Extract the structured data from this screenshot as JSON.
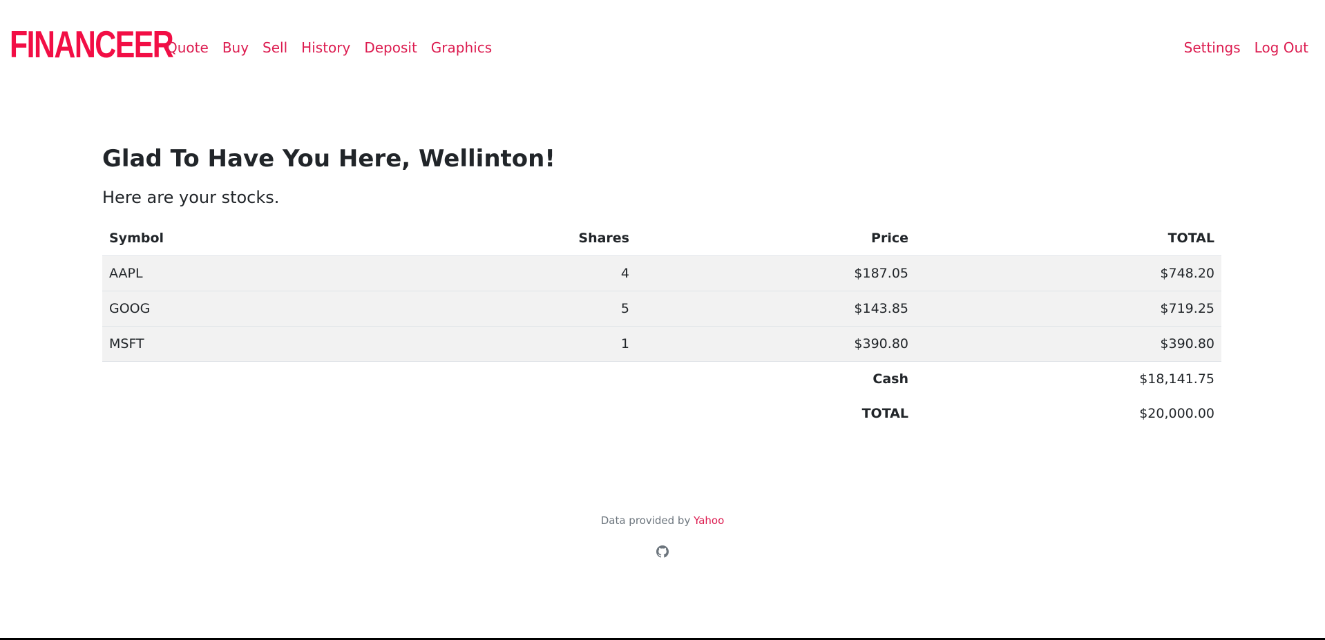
{
  "brand": {
    "name": "FINANCEER",
    "color": "#f20e45"
  },
  "nav": {
    "left": [
      {
        "label": "Quote"
      },
      {
        "label": "Buy"
      },
      {
        "label": "Sell"
      },
      {
        "label": "History"
      },
      {
        "label": "Deposit"
      },
      {
        "label": "Graphics"
      }
    ],
    "right": [
      {
        "label": "Settings"
      },
      {
        "label": "Log Out"
      }
    ],
    "link_color": "#dc1b4f"
  },
  "main": {
    "heading": "Glad To Have You Here, Wellinton!",
    "subheading": "Here are your stocks."
  },
  "table": {
    "headers": {
      "symbol": "Symbol",
      "shares": "Shares",
      "price": "Price",
      "total": "TOTAL"
    },
    "rows": [
      {
        "symbol": "AAPL",
        "shares": "4",
        "price": "$187.05",
        "total": "$748.20"
      },
      {
        "symbol": "GOOG",
        "shares": "5",
        "price": "$143.85",
        "total": "$719.25"
      },
      {
        "symbol": "MSFT",
        "shares": "1",
        "price": "$390.80",
        "total": "$390.80"
      }
    ],
    "cash": {
      "label": "Cash",
      "value": "$18,141.75"
    },
    "grand_total": {
      "label": "TOTAL",
      "value": "$20,000.00"
    }
  },
  "footer": {
    "text": "Data provided by",
    "link_label": "Yahoo",
    "icon": "github-icon"
  }
}
